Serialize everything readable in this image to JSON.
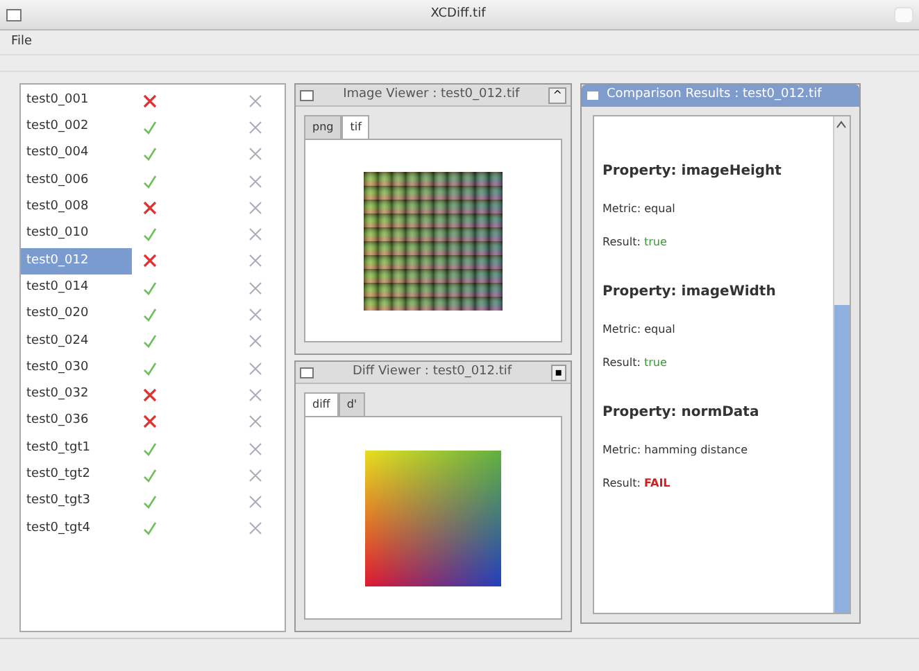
{
  "window": {
    "title": "XCDiff.tif"
  },
  "menu": [
    "File"
  ],
  "files": [
    {
      "name": "test0_001",
      "kind": "fail",
      "selected": false
    },
    {
      "name": "test0_002",
      "kind": "pass",
      "selected": false
    },
    {
      "name": "test0_004",
      "kind": "pass",
      "selected": false
    },
    {
      "name": "test0_006",
      "kind": "pass",
      "selected": false
    },
    {
      "name": "test0_008",
      "kind": "fail",
      "selected": false
    },
    {
      "name": "test0_010",
      "kind": "pass",
      "selected": false
    },
    {
      "name": "test0_012",
      "kind": "fail",
      "selected": true
    },
    {
      "name": "test0_014",
      "kind": "pass",
      "selected": false
    },
    {
      "name": "test0_020",
      "kind": "pass",
      "selected": false
    },
    {
      "name": "test0_024",
      "kind": "pass",
      "selected": false
    },
    {
      "name": "test0_030",
      "kind": "pass",
      "selected": false
    },
    {
      "name": "test0_032",
      "kind": "fail",
      "selected": false
    },
    {
      "name": "test0_036",
      "kind": "fail",
      "selected": false
    },
    {
      "name": "test0_tgt1",
      "kind": "pass",
      "selected": false
    },
    {
      "name": "test0_tgt2",
      "kind": "pass",
      "selected": false
    },
    {
      "name": "test0_tgt3",
      "kind": "pass",
      "selected": false
    },
    {
      "name": "test0_tgt4",
      "kind": "pass",
      "selected": false
    }
  ],
  "viewers": [
    {
      "title": "Image Viewer : test0_012.tif",
      "button": "^",
      "tabs": [
        {
          "label": "png",
          "selected": false
        },
        {
          "label": "tif",
          "selected": true
        }
      ],
      "kind": "grid"
    },
    {
      "title": "Diff Viewer : test0_012.tif",
      "button": "▪",
      "tabs": [
        {
          "label": "diff",
          "selected": true
        },
        {
          "label": "d'",
          "selected": false
        }
      ],
      "kind": "gradient"
    }
  ],
  "report": {
    "title": "Comparison Results : test0_012.tif",
    "entries": [
      {
        "kind": "heading",
        "text": "Property: imageHeight"
      },
      {
        "kind": "metric",
        "label": "Metric:",
        "value": "equal"
      },
      {
        "kind": "result",
        "label": "Result:",
        "value": "true",
        "passed": true
      },
      {
        "kind": "heading",
        "text": "Property: imageWidth"
      },
      {
        "kind": "metric",
        "label": "Metric:",
        "value": "equal"
      },
      {
        "kind": "result",
        "label": "Result:",
        "value": "true",
        "passed": true
      },
      {
        "kind": "heading",
        "text": "Property: normData"
      },
      {
        "kind": "metric",
        "label": "Metric:",
        "value": "hamming distance"
      },
      {
        "kind": "result",
        "label": "Result:",
        "value": "FAIL",
        "passed": false
      }
    ]
  }
}
